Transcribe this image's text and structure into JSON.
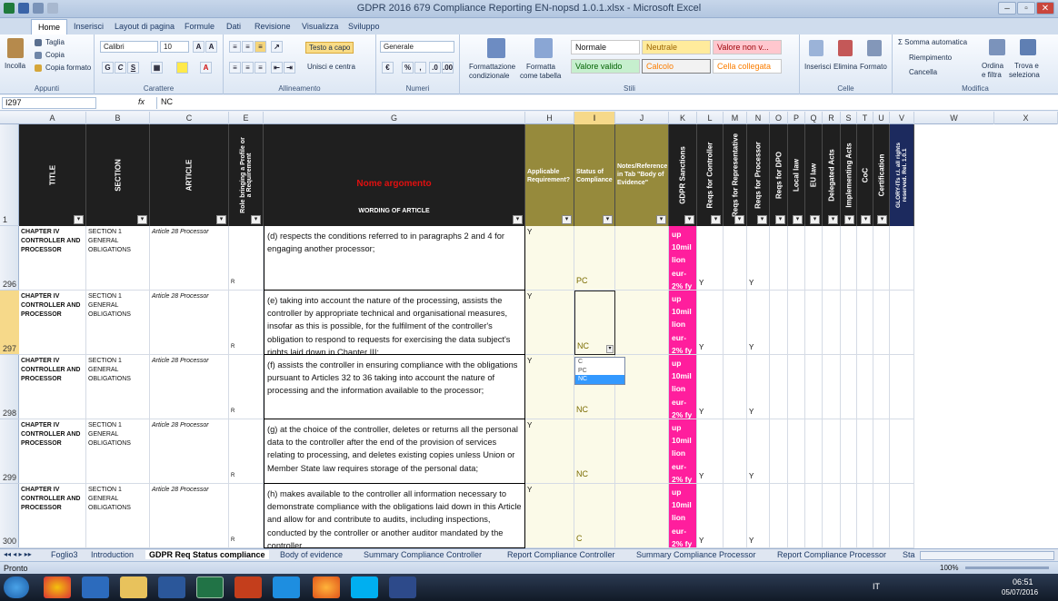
{
  "window": {
    "title": "GDPR 2016 679 Compliance Reporting EN-nopsd 1.0.1.xlsx - Microsoft Excel"
  },
  "tabs": [
    "Home",
    "Inserisci",
    "Layout di pagina",
    "Formule",
    "Dati",
    "Revisione",
    "Visualizza",
    "Sviluppo"
  ],
  "ribbon": {
    "incolla": "Incolla",
    "taglia": "Taglia",
    "copia": "Copia",
    "copia_formato": "Copia formato",
    "appunti": "Appunti",
    "font_name": "Calibri",
    "font_size": "10",
    "carattere": "Carattere",
    "testo_a_capo": "Testo a capo",
    "unisci": "Unisci e centra",
    "allineamento": "Allineamento",
    "num_format": "Generale",
    "numeri": "Numeri",
    "formattazione_condizionale": [
      "Formattazione",
      "condizionale"
    ],
    "formatta_tabella": [
      "Formatta",
      "come tabella"
    ],
    "styles": {
      "normale": "Normale",
      "neutrale": "Neutrale",
      "valore_non": "Valore non v...",
      "valore_valido": "Valore valido",
      "calcolo": "Calcolo",
      "cella_collegata": "Cella collegata"
    },
    "stili": "Stili",
    "inserisci": "Inserisci",
    "elimina": "Elimina",
    "formato": "Formato",
    "celle": "Celle",
    "somma": "Somma automatica",
    "riempimento": "Riempimento",
    "cancella": "Cancella",
    "ordina": [
      "Ordina",
      "e filtra"
    ],
    "trova": [
      "Trova e",
      "seleziona"
    ],
    "modifica": "Modifica"
  },
  "formula": {
    "name_box": "I297",
    "fx": "fx",
    "value": "NC"
  },
  "columns": [
    "A",
    "B",
    "C",
    "E",
    "G",
    "H",
    "I",
    "J",
    "K",
    "L",
    "M",
    "N",
    "O",
    "P",
    "Q",
    "R",
    "S",
    "T",
    "U",
    "V",
    "W",
    "X"
  ],
  "header": {
    "title": "TITLE",
    "section": "SECTION",
    "article": "ARTICLE",
    "role": "Role bringing a Profile or a Requirement",
    "nome": "Nome argomento",
    "wording": "WORDING OF ARTICLE",
    "applicable": "Applicable Requirement?",
    "status": "Status of Compliance",
    "notes": "Notes/Reference in Tab \"Body of Evidence\"",
    "sanctions": "GDPR Sanctions",
    "controller": "Reqs for Controller",
    "representative": "Reqs for Representative",
    "processor": "Reqs for Processor",
    "dpo": "Reqs for DPO",
    "local": "Local law",
    "eu": "EU law",
    "delegated": "Delegated Acts",
    "implementing": "Implementing Acts",
    "coc": "CoC",
    "cert": "Certification",
    "copyright": "GLORY-ITs r.l. all rights reserved. Rel. 1.0.1",
    "row": "1"
  },
  "rows": [
    {
      "num": "296",
      "title": "CHAPTER IV CONTROLLER AND PROCESSOR",
      "section": "SECTION 1 GENERAL OBLIGATIONS",
      "article": "Article 28 Processor",
      "r": "R",
      "text": "(d) respects the conditions referred to in paragraphs 2 and 4 for engaging another processor;",
      "h": "Y",
      "i": "PC",
      "k": "up 10mil lion eur- 2% fy",
      "l": "Y",
      "n": "Y"
    },
    {
      "num": "297",
      "title": "CHAPTER IV CONTROLLER AND PROCESSOR",
      "section": "SECTION 1 GENERAL OBLIGATIONS",
      "article": "Article 28 Processor",
      "r": "R",
      "text": "(e) taking into account the nature of the processing, assists the controller by appropriate technical and organisational measures, insofar as this is possible, for the fulfilment of the controller's obligation to respond to requests for exercising the data subject's rights laid down in Chapter III;",
      "h": "Y",
      "i": "NC",
      "k": "up 10mil lion eur- 2% fy",
      "l": "Y",
      "n": "Y"
    },
    {
      "num": "298",
      "title": "CHAPTER IV CONTROLLER AND PROCESSOR",
      "section": "SECTION 1 GENERAL OBLIGATIONS",
      "article": "Article 28 Processor",
      "r": "R",
      "text": "(f) assists the controller in ensuring compliance with the obligations pursuant to Articles 32 to 36 taking into account the nature of processing and the information available to the processor;",
      "h": "Y",
      "i": "NC",
      "k": "up 10mil lion eur- 2% fy",
      "l": "Y",
      "n": "Y"
    },
    {
      "num": "299",
      "title": "CHAPTER IV CONTROLLER AND PROCESSOR",
      "section": "SECTION 1 GENERAL OBLIGATIONS",
      "article": "Article 28 Processor",
      "r": "R",
      "text": "(g) at the choice of the controller, deletes or returns all the personal data to the controller after the end of the provision of services relating to processing, and deletes existing copies unless Union or Member State law requires storage of the personal data;",
      "h": "Y",
      "i": "NC",
      "k": "up 10mil lion eur- 2% fy",
      "l": "Y",
      "n": "Y"
    },
    {
      "num": "300",
      "title": "CHAPTER IV CONTROLLER AND PROCESSOR",
      "section": "SECTION 1 GENERAL OBLIGATIONS",
      "article": "Article 28 Processor",
      "r": "R",
      "text": "(h) makes available to the controller all information necessary to demonstrate compliance with the obligations laid down in this Article and allow for and contribute to audits, including inspections, conducted by the controller or another auditor mandated by the controller.",
      "h": "Y",
      "i": "C",
      "k": "up 10mil lion eur- 2% fy",
      "l": "Y",
      "n": "Y"
    }
  ],
  "dropdown": [
    "C",
    "PC",
    "NC"
  ],
  "sheets": [
    "Foglio3",
    "Introduction",
    "GDPR Req Status compliance",
    "Body of evidence",
    "Summary Compliance  Controller",
    "Report Compliance Controller",
    "Summary Compliance Processor",
    "Report Compliance Processor",
    "Sta"
  ],
  "status": {
    "left": "Pronto",
    "zoom": "100%"
  },
  "taskbar": {
    "lang": "IT",
    "time": "06:51",
    "date": "05/07/2016"
  }
}
